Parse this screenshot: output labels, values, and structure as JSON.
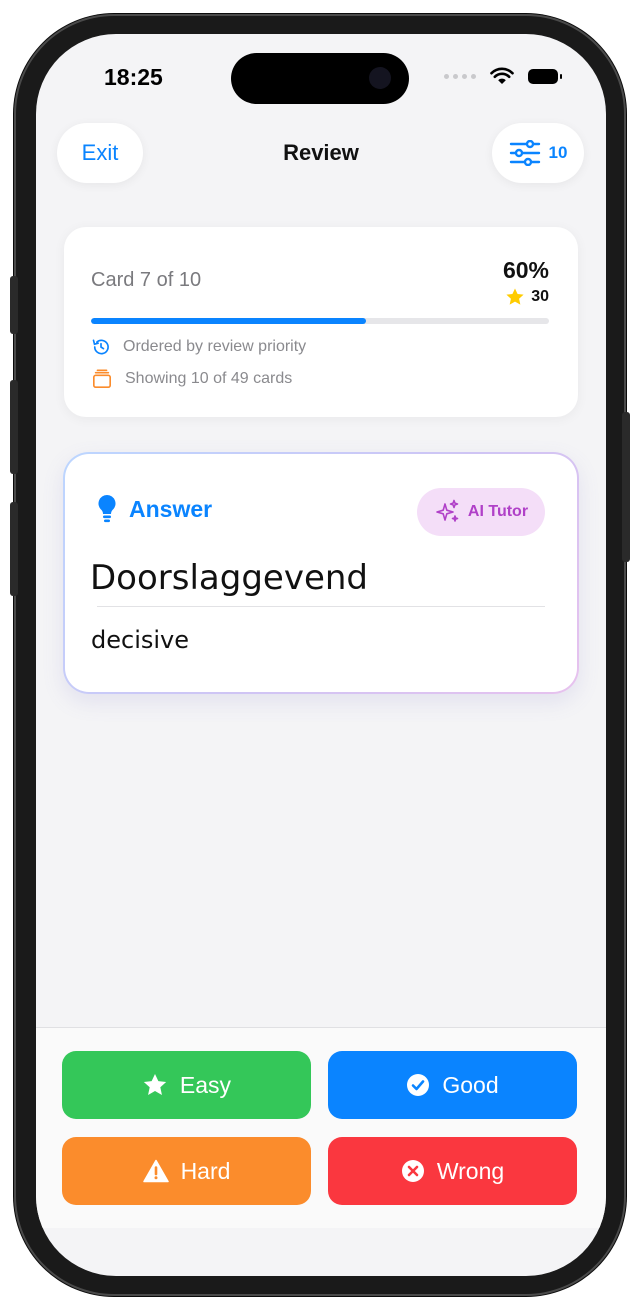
{
  "status_bar": {
    "time": "18:25"
  },
  "nav": {
    "exit_label": "Exit",
    "title": "Review",
    "filter_count": "10"
  },
  "progress": {
    "card_label": "Card 7 of 10",
    "percent_label": "60%",
    "percent_value": 60,
    "stars": "30",
    "order_text": "Ordered by review priority",
    "showing_text": "Showing 10 of 49 cards"
  },
  "answer": {
    "label": "Answer",
    "tutor_label": "AI Tutor",
    "term": "Doorslaggevend",
    "translation": "decisive"
  },
  "grades": {
    "easy": "Easy",
    "good": "Good",
    "hard": "Hard",
    "wrong": "Wrong"
  },
  "colors": {
    "accent": "#0a84ff",
    "easy": "#34c759",
    "good": "#0a84ff",
    "hard": "#fb8c2c",
    "wrong": "#fa373f",
    "tutor": "#b040c8"
  },
  "icons": [
    "filter-sliders-icon",
    "star-icon",
    "history-icon",
    "stack-icon",
    "lightbulb-icon",
    "sparkles-icon",
    "checkmark-circle-icon",
    "warning-triangle-icon",
    "x-circle-icon"
  ]
}
